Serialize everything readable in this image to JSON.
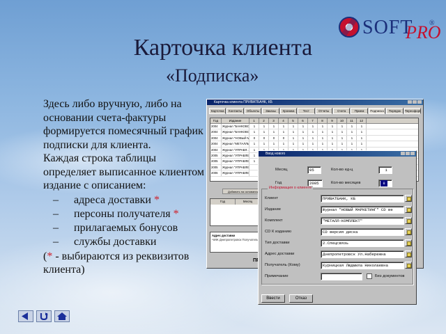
{
  "logo": {
    "soft": "SOFT",
    "pro": "PRO",
    "reg": "®"
  },
  "title": "Карточка клиента",
  "subtitle": "«Подписка»",
  "intro": "Здесь либо вручную, либо на основании счета-фактуры формируется помесячный график подписки для клиента.",
  "para2": "Каждая строка таблицы определяет выписанное клиентом издание с описанием:",
  "bullets": [
    {
      "text": "адреса доставки",
      "star": " *"
    },
    {
      "text": "персоны получателя",
      "star": " *"
    },
    {
      "text": "прилагаемых бонусов",
      "star": ""
    },
    {
      "text": "службы доставки",
      "star": ""
    }
  ],
  "footnote": {
    "open": "(",
    "star": "*",
    "rest": " - выбираются из реквизитов клиента)"
  },
  "nav": {
    "back_icon": "arrow-left-icon",
    "return_icon": "return-icon",
    "home_icon": "home-icon"
  },
  "back_window": {
    "title": "Карточка клиента ПРИВАТБАНК, КБ",
    "tabs": [
      "Карточка",
      "Контакты",
      "Объекты",
      "Заказы",
      "Хроника",
      "Тест",
      "Отчеты",
      "Счета",
      "Прием",
      "Подписка",
      "Порядок",
      "Переоформл"
    ],
    "grid_header": [
      "Год",
      "Издание",
      "1",
      "2",
      "3",
      "4",
      "5",
      "6",
      "7",
      "8",
      "9",
      "10",
      "11",
      "12"
    ],
    "rows": [
      {
        "year": "2004",
        "title": "Журнал \"БАНКОВСКА...",
        "cells": [
          "1",
          "1",
          "1",
          "1",
          "1",
          "1",
          "1",
          "1",
          "1",
          "1",
          "1",
          "1"
        ]
      },
      {
        "year": "2004",
        "title": "Журнал \"БАНКОВСКА...",
        "cells": [
          "1",
          "1",
          "1",
          "1",
          "1",
          "1",
          "1",
          "1",
          "1",
          "1",
          "1",
          "1"
        ]
      },
      {
        "year": "2004",
        "title": "Журнал \"НОВЫЙ МАР...",
        "cells": [
          "0",
          "0",
          "0",
          "0",
          "1",
          "1",
          "1",
          "1",
          "1",
          "1",
          "1",
          "1"
        ]
      },
      {
        "year": "2004",
        "title": "Журнал \"МЕТАЛЛЫ",
        "cells": [
          "1",
          "1",
          "1",
          "1",
          "1",
          "1",
          "1",
          "1",
          "1",
          "1",
          "1",
          "1"
        ]
      },
      {
        "year": "2004",
        "title": "Журнал \"УПРАВЛ...",
        "cells": [
          "1",
          "1",
          "1",
          "1",
          "1",
          "1",
          "1",
          "1",
          "1",
          "1",
          "1",
          "1"
        ]
      },
      {
        "year": "2005",
        "title": "Журнал \"УПРАВЛЕН...",
        "cells": [
          "1",
          "1",
          "1",
          "1",
          "1",
          "",
          "",
          "",
          "",
          "",
          "",
          ""
        ]
      },
      {
        "year": "2005",
        "title": "Журнал \"УПРАВЛЕН...",
        "cells": [
          "1",
          "1",
          "1",
          "1",
          "",
          "",
          "",
          "",
          "",
          "",
          "",
          ""
        ]
      },
      {
        "year": "2005",
        "title": "Журнал \"УПРАВЛЕН...",
        "cells": [
          "",
          "",
          "",
          "",
          "",
          "",
          "",
          "",
          "",
          "",
          "",
          ""
        ]
      },
      {
        "year": "2006",
        "title": "Журнал \"УПРАВЛЕН...",
        "cells": [
          "",
          "",
          "",
          "",
          "",
          "",
          "",
          "",
          "",
          "",
          "",
          ""
        ]
      }
    ],
    "add_button": "Добавить на основании",
    "grid2_header": [
      "Год",
      "Месяц",
      "Бон"
    ],
    "address_label": "Адрес доставки",
    "address_text": "ЧИЖ Днепропетровск Получатель Библиотека",
    "bottom_label": "ПР"
  },
  "front_window": {
    "title": "Ввод нового",
    "month_label": "Месяц",
    "month_value": "05",
    "qty_label": "Кол-во ед-ц",
    "qty_value": "1",
    "year_label": "Год",
    "year_value": "2005",
    "months_label": "Кол-во месяцев",
    "months_value": "8",
    "group_label": "Информация о клиенте",
    "fields": [
      {
        "label": "Клиент",
        "value": "ПРИВАТБАНК, КБ",
        "wide": false
      },
      {
        "label": "Издание",
        "value": "Журнал \"НОВЫЙ МАРКЕТИНГ\" CD ве",
        "wide": true
      },
      {
        "label": "Комплект",
        "value": "\"МЕТАЛЛ-КОМПЛЕКТ\"",
        "wide": true
      },
      {
        "label": "CD  К изданию",
        "value": "CD версия диска",
        "wide": true
      },
      {
        "label": "Тип доставки",
        "value": "2.Спецсвязь",
        "wide": true
      },
      {
        "label": "Адрес доставки",
        "value": "Днепропетровск  Ул.Набережна",
        "wide": true
      },
      {
        "label": "Получатель (Кому)",
        "value": "Курницкая Людмила Николаевна",
        "wide": true
      },
      {
        "label": "Примечание",
        "value": "",
        "wide": false
      }
    ],
    "no_docs_label": "Без документов",
    "ok_button": "Ввести",
    "cancel_button": "Отказ"
  }
}
